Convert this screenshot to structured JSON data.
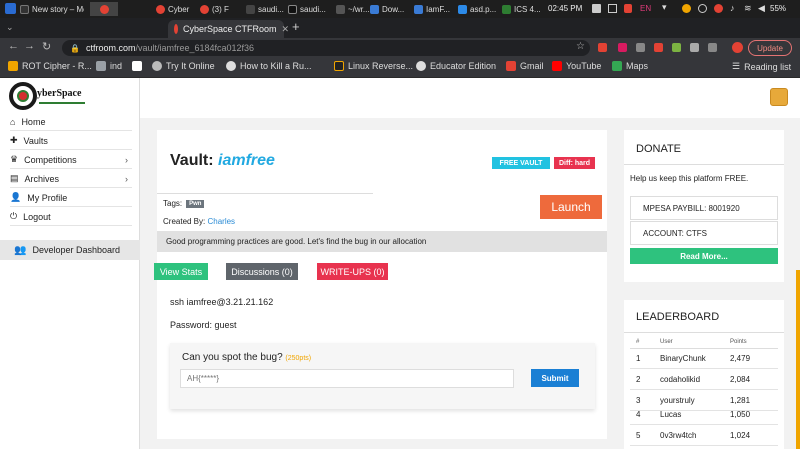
{
  "os": {
    "tasks": [
      "New story – Medium",
      "Cyber",
      "(3) F",
      "saudi...",
      "saudi...",
      "~/wr...",
      "Dow...",
      "IamF...",
      "asd.p...",
      "ICS 4..."
    ],
    "time": "02:45 PM",
    "lang": "EN",
    "battery": "55%"
  },
  "browser": {
    "tab_title": "CyberSpace CTFRoom",
    "new_tab": "+",
    "url_host": "ctfroom.com",
    "url_path": "/vault/iamfree_6184fca012f36",
    "update_label": "Update",
    "bookmarks": [
      "ROT Cipher - R...",
      "ind",
      "Try It Online",
      "How to Kill a Ru...",
      "Linux Reverse...",
      "Educator Edition",
      "Gmail",
      "YouTube",
      "Maps"
    ],
    "reading_list": "Reading list"
  },
  "logo": {
    "text": "yberSpace"
  },
  "sidebar": {
    "items": [
      {
        "label": "Home"
      },
      {
        "label": "Vaults"
      },
      {
        "label": "Competitions"
      },
      {
        "label": "Archives"
      },
      {
        "label": "My Profile"
      },
      {
        "label": "Logout"
      }
    ],
    "dev_dashboard": "Developer Dashboard"
  },
  "vault": {
    "prefix": "Vault:",
    "name": "iamfree",
    "badge_free": "FREE VAULT",
    "badge_diff": "Diff: hard",
    "tags_label": "Tags:",
    "tag": "Pwn",
    "created_label": "Created By:",
    "created_by": "Charles",
    "launch": "Launch",
    "description": "Good programming practices are good. Let's find the bug in our allocation",
    "tabs": {
      "stats": "View Stats",
      "discussions": "Discussions (0)",
      "writeups": "WRITE-UPS (0)"
    },
    "ssh": "ssh iamfree@3.21.21.162",
    "password": "Password: guest",
    "question": "Can you spot the bug?",
    "points": "(250pts)",
    "flag_placeholder": "AH{*****}",
    "submit": "Submit"
  },
  "donate": {
    "title": "DONATE",
    "desc": "Help us keep this platform FREE.",
    "paybill": "MPESA PAYBILL: 8001920",
    "account": "ACCOUNT: CTFS",
    "read_more": "Read More..."
  },
  "leaderboard": {
    "title": "LEADERBOARD",
    "headers": {
      "rank": "#",
      "user": "User",
      "points": "Points"
    },
    "rows": [
      {
        "rank": "1",
        "user": "BinaryChunk",
        "points": "2,479"
      },
      {
        "rank": "2",
        "user": "codaholikid",
        "points": "2,084"
      },
      {
        "rank": "3",
        "user": "yourstruly",
        "points": "1,281"
      },
      {
        "rank": "4",
        "user": "Lucas",
        "points": "1,050"
      },
      {
        "rank": "5",
        "user": "0v3rw4tch",
        "points": "1,024"
      }
    ]
  },
  "colors": {
    "accent_blue": "#21a9e1",
    "launch_orange": "#ee6a3c",
    "view_stats_green": "#2ec27e",
    "writeups_red": "#e8334f",
    "discussions_gray": "#5f656b",
    "submit_blue": "#1a7fd4"
  }
}
